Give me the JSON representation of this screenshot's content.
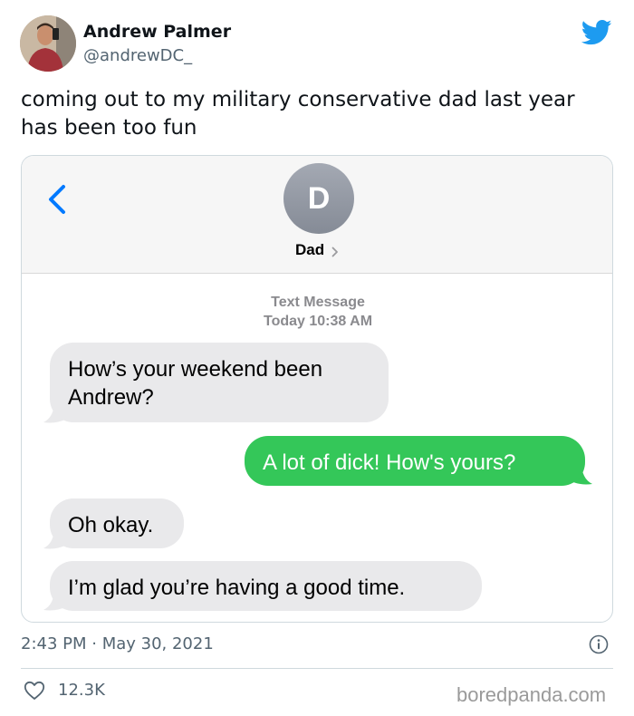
{
  "author": {
    "name": "Andrew Palmer",
    "handle": "@andrewDC_"
  },
  "tweet": {
    "text": "coming out to my military conservative dad last year has been too fun",
    "timestamp": "2:43 PM · May 30, 2021",
    "like_count": "12.3K"
  },
  "screenshot": {
    "contact_initial": "D",
    "contact_name": "Dad",
    "meta_line1": "Text Message",
    "meta_line2": "Today 10:38 AM",
    "messages": [
      {
        "direction": "incoming",
        "text": "How’s your weekend been Andrew?"
      },
      {
        "direction": "outgoing",
        "text": "A lot of dick! How's yours?"
      },
      {
        "direction": "incoming",
        "text": "Oh okay."
      },
      {
        "direction": "incoming",
        "text": "I’m glad you’re having a good time."
      }
    ]
  },
  "watermark": "boredpanda.com",
  "icons": {
    "brand": "twitter-bird-icon",
    "back": "chevron-left-icon",
    "contact": "chevron-right-icon",
    "info": "info-icon",
    "like": "heart-icon"
  },
  "colors": {
    "twitter_blue": "#1d9bf0",
    "imessage_blue": "#007aff",
    "sms_green": "#34c759",
    "incoming_bubble": "#e9e9eb",
    "secondary_text": "#536471"
  }
}
